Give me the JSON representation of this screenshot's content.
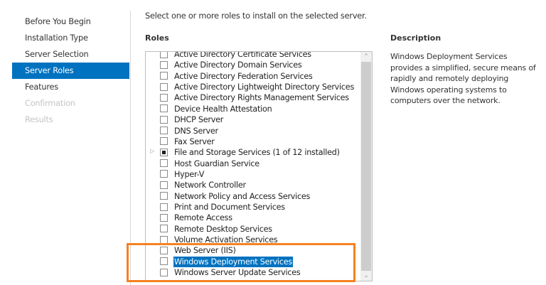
{
  "sidebar": {
    "items": [
      {
        "label": "Before You Begin",
        "state": "normal"
      },
      {
        "label": "Installation Type",
        "state": "normal"
      },
      {
        "label": "Server Selection",
        "state": "normal"
      },
      {
        "label": "Server Roles",
        "state": "active"
      },
      {
        "label": "Features",
        "state": "normal"
      },
      {
        "label": "Confirmation",
        "state": "disabled"
      },
      {
        "label": "Results",
        "state": "disabled"
      }
    ]
  },
  "main": {
    "instruction": "Select one or more roles to install on the selected server.",
    "roles_heading": "Roles",
    "roles": [
      {
        "label": "Active Directory Certificate Services"
      },
      {
        "label": "Active Directory Domain Services"
      },
      {
        "label": "Active Directory Federation Services"
      },
      {
        "label": "Active Directory Lightweight Directory Services"
      },
      {
        "label": "Active Directory Rights Management Services"
      },
      {
        "label": "Device Health Attestation"
      },
      {
        "label": "DHCP Server"
      },
      {
        "label": "DNS Server"
      },
      {
        "label": "Fax Server"
      },
      {
        "label": "File and Storage Services (1 of 12 installed)",
        "partial": true,
        "expandable": true
      },
      {
        "label": "Host Guardian Service"
      },
      {
        "label": "Hyper-V"
      },
      {
        "label": "Network Controller"
      },
      {
        "label": "Network Policy and Access Services"
      },
      {
        "label": "Print and Document Services"
      },
      {
        "label": "Remote Access"
      },
      {
        "label": "Remote Desktop Services"
      },
      {
        "label": "Volume Activation Services"
      },
      {
        "label": "Web Server (IIS)"
      },
      {
        "label": "Windows Deployment Services",
        "selected": true
      },
      {
        "label": "Windows Server Update Services"
      }
    ],
    "description_heading": "Description",
    "description": "Windows Deployment Services provides a simplified, secure means of rapidly and remotely deploying Windows operating systems to computers over the network."
  },
  "colors": {
    "accent": "#0072c0",
    "highlight_box": "#f58220"
  }
}
